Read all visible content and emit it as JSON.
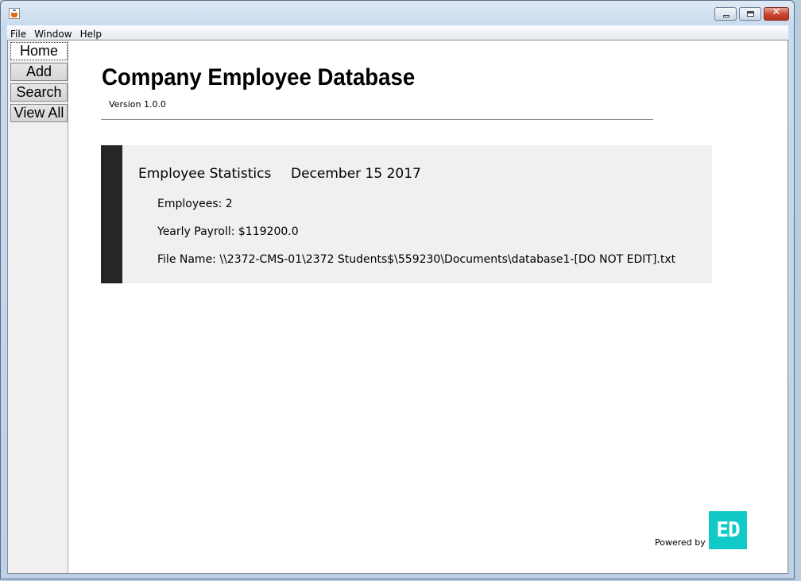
{
  "window": {
    "app_icon": "java-coffee-icon",
    "controls": [
      "minimize-icon",
      "maximize-icon",
      "close-icon"
    ]
  },
  "menubar": {
    "items": [
      "File",
      "Window",
      "Help"
    ]
  },
  "sidebar": {
    "items": [
      {
        "label": "Home",
        "active": true
      },
      {
        "label": "Add",
        "active": false
      },
      {
        "label": "Search",
        "active": false
      },
      {
        "label": "View All",
        "active": false
      }
    ]
  },
  "main": {
    "title": "Company Employee Database",
    "version": "Version 1.0.0",
    "stats": {
      "heading": "Employee Statistics",
      "date": "December 15 2017",
      "employees": "Employees: 2",
      "payroll": "Yearly Payroll: $119200.0",
      "file_name": "File Name: \\\\2372-CMS-01\\2372 Students$\\559230\\Documents\\database1-[DO NOT EDIT].txt"
    },
    "footer": {
      "powered_by": "Powered by",
      "logo_text": "ED",
      "logo_color": "#11c9c6"
    }
  }
}
